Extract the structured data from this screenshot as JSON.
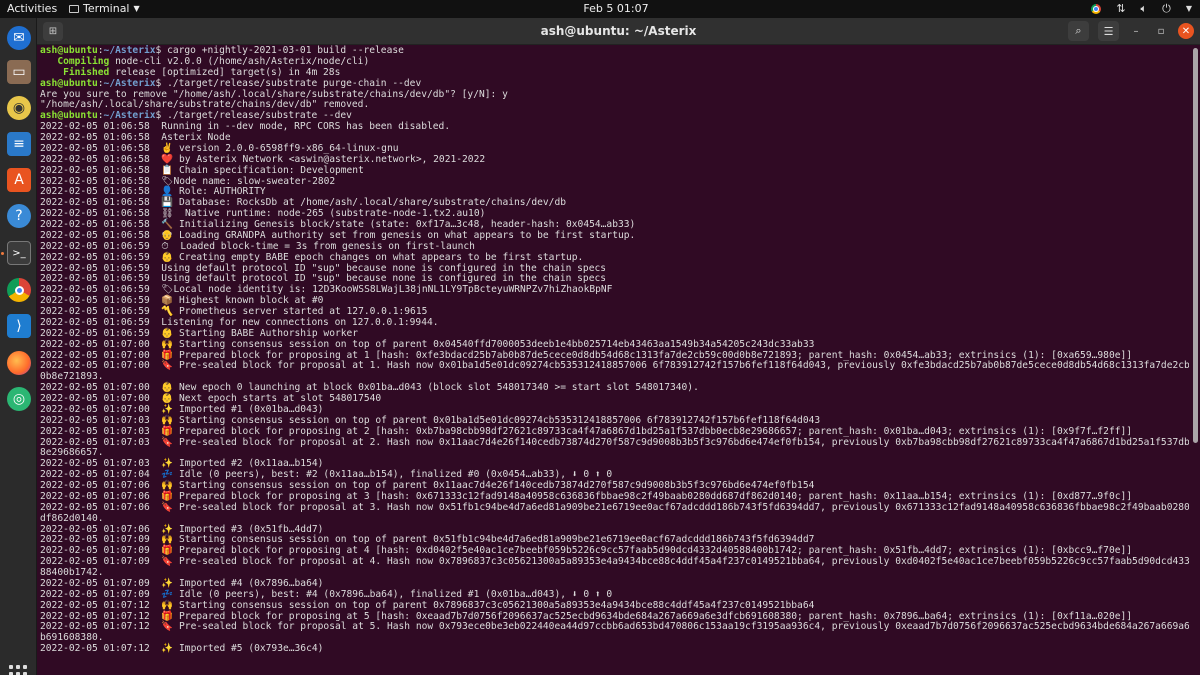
{
  "topbar": {
    "activities": "Activities",
    "app_name": "Terminal",
    "clock": "Feb 5  01:07"
  },
  "dock": {
    "apps": [
      {
        "name": "Thunderbird",
        "icon": "thunderbird-icon"
      },
      {
        "name": "Files",
        "icon": "files-icon"
      },
      {
        "name": "Rhythmbox",
        "icon": "rhythmbox-icon"
      },
      {
        "name": "LibreOffice Writer",
        "icon": "writer-icon"
      },
      {
        "name": "Ubuntu Software",
        "icon": "software-icon"
      },
      {
        "name": "Help",
        "icon": "help-icon"
      },
      {
        "name": "Terminal",
        "icon": "terminal-icon"
      },
      {
        "name": "Google Chrome",
        "icon": "chrome-icon"
      },
      {
        "name": "Visual Studio Code",
        "icon": "vscode-icon"
      },
      {
        "name": "Firefox",
        "icon": "firefox-icon"
      },
      {
        "name": "App",
        "icon": "green-app-icon"
      }
    ]
  },
  "window": {
    "title": "ash@ubuntu: ~/Asterix"
  },
  "terminal": {
    "lines": [
      {
        "u": "ash@ubuntu",
        "p": "~/Asterix",
        "t": "$ cargo +nightly-2021-03-01 build --release"
      },
      {
        "g": "   Compiling",
        "t": " node-cli v2.0.0 (/home/ash/Asterix/node/cli)"
      },
      {
        "g": "    Finished",
        "t": " release [optimized] target(s) in 4m 28s"
      },
      {
        "u": "ash@ubuntu",
        "p": "~/Asterix",
        "t": "$ ./target/release/substrate purge-chain --dev"
      },
      {
        "t": "Are you sure to remove \"/home/ash/.local/share/substrate/chains/dev/db\"? [y/N]: y"
      },
      {
        "t": "\"/home/ash/.local/share/substrate/chains/dev/db\" removed."
      },
      {
        "u": "ash@ubuntu",
        "p": "~/Asterix",
        "t": "$ ./target/release/substrate --dev"
      },
      {
        "t": "2022-02-05 01:06:58  Running in --dev mode, RPC CORS has been disabled."
      },
      {
        "t": "2022-02-05 01:06:58  Asterix Node"
      },
      {
        "t": "2022-02-05 01:06:58  ✌️ version 2.0.0-6598ff9-x86_64-linux-gnu"
      },
      {
        "t": "2022-02-05 01:06:58  ❤️ by Asterix Network <aswin@asterix.network>, 2021-2022"
      },
      {
        "t": "2022-02-05 01:06:58  📋 Chain specification: Development"
      },
      {
        "t": "2022-02-05 01:06:58  🏷Node name: slow-sweater-2802"
      },
      {
        "t": "2022-02-05 01:06:58  👤 Role: AUTHORITY"
      },
      {
        "t": "2022-02-05 01:06:58  💾 Database: RocksDb at /home/ash/.local/share/substrate/chains/dev/db"
      },
      {
        "t": "2022-02-05 01:06:58  ⛓  Native runtime: node-265 (substrate-node-1.tx2.au10)"
      },
      {
        "t": "2022-02-05 01:06:58  🔨 Initializing Genesis block/state (state: 0xf17a…3c48, header-hash: 0x0454…ab33)"
      },
      {
        "t": "2022-02-05 01:06:58  👴 Loading GRANDPA authority set from genesis on what appears to be first startup."
      },
      {
        "t": "2022-02-05 01:06:59  ⏱  Loaded block-time = 3s from genesis on first-launch"
      },
      {
        "t": "2022-02-05 01:06:59  👶 Creating empty BABE epoch changes on what appears to be first startup."
      },
      {
        "t": "2022-02-05 01:06:59  Using default protocol ID \"sup\" because none is configured in the chain specs"
      },
      {
        "t": "2022-02-05 01:06:59  Using default protocol ID \"sup\" because none is configured in the chain specs"
      },
      {
        "t": "2022-02-05 01:06:59  🏷Local node identity is: 12D3KooWSS8LWajL38jnNL1LY9TpBcteyuWRNPZv7hiZhaokBpNF"
      },
      {
        "t": "2022-02-05 01:06:59  📦 Highest known block at #0"
      },
      {
        "t": "2022-02-05 01:06:59  〽️ Prometheus server started at 127.0.0.1:9615"
      },
      {
        "t": "2022-02-05 01:06:59  Listening for new connections on 127.0.0.1:9944."
      },
      {
        "t": "2022-02-05 01:06:59  👶 Starting BABE Authorship worker"
      },
      {
        "t": "2022-02-05 01:07:00  🙌 Starting consensus session on top of parent 0x04540ffd7000053deeb1e4bb025714eb43463aa1549b34a54205c243dc33ab33"
      },
      {
        "t": "2022-02-05 01:07:00  🎁 Prepared block for proposing at 1 [hash: 0xfe3bdacd25b7ab0b87de5cece0d8db54d68c1313fa7de2cb59c00d0b8e721893; parent_hash: 0x0454…ab33; extrinsics (1): [0xa659…980e]]"
      },
      {
        "t": "2022-02-05 01:07:00  🔖 Pre-sealed block for proposal at 1. Hash now 0x01ba1d5e01dc09274cb535312418857006 6f783912742f157b6fef118f64d043, previously 0xfe3bdacd25b7ab0b87de5cece0d8db54d68c1313fa7de2cb59c00d"
      },
      {
        "t": "0b8e721893."
      },
      {
        "t": "2022-02-05 01:07:00  👶 New epoch 0 launching at block 0x01ba…d043 (block slot 548017340 >= start slot 548017340)."
      },
      {
        "t": "2022-02-05 01:07:00  👶 Next epoch starts at slot 548017540"
      },
      {
        "t": "2022-02-05 01:07:00  ✨ Imported #1 (0x01ba…d043)"
      },
      {
        "t": "2022-02-05 01:07:03  🙌 Starting consensus session on top of parent 0x01ba1d5e01dc09274cb535312418857006 6f783912742f157b6fef118f64d043"
      },
      {
        "t": "2022-02-05 01:07:03  🎁 Prepared block for proposing at 2 [hash: 0xb7ba98cbb98df27621c89733ca4f47a6867d1bd25a1f537dbb0ecb8e29686657; parent_hash: 0x01ba…d043; extrinsics (1): [0x9f7f…f2ff]]"
      },
      {
        "t": "2022-02-05 01:07:03  🔖 Pre-sealed block for proposal at 2. Hash now 0x11aac7d4e26f140cedb73874d270f587c9d9008b3b5f3c976bd6e474ef0fb154, previously 0xb7ba98cbb98df27621c89733ca4f47a6867d1bd25a1f537dbb0ecb"
      },
      {
        "t": "8e29686657."
      },
      {
        "t": "2022-02-05 01:07:03  ✨ Imported #2 (0x11aa…b154)"
      },
      {
        "t": "2022-02-05 01:07:04  💤 Idle (0 peers), best: #2 (0x11aa…b154), finalized #0 (0x0454…ab33), ⬇ 0 ⬆ 0"
      },
      {
        "t": "2022-02-05 01:07:06  🙌 Starting consensus session on top of parent 0x11aac7d4e26f140cedb73874d270f587c9d9008b3b5f3c976bd6e474ef0fb154"
      },
      {
        "t": "2022-02-05 01:07:06  🎁 Prepared block for proposing at 3 [hash: 0x671333c12fad9148a40958c636836fbbae98c2f49baab0280dd687df862d0140; parent_hash: 0x11aa…b154; extrinsics (1): [0xd877…9f0c]]"
      },
      {
        "t": "2022-02-05 01:07:06  🔖 Pre-sealed block for proposal at 3. Hash now 0x51fb1c94be4d7a6ed81a909be21e6719ee0acf67adcddd186b743f5fd6394dd7, previously 0x671333c12fad9148a40958c636836fbbae98c2f49baab0280dd687"
      },
      {
        "t": "df862d0140."
      },
      {
        "t": "2022-02-05 01:07:06  ✨ Imported #3 (0x51fb…4dd7)"
      },
      {
        "t": "2022-02-05 01:07:09  🙌 Starting consensus session on top of parent 0x51fb1c94be4d7a6ed81a909be21e6719ee0acf67adcddd186b743f5fd6394dd7"
      },
      {
        "t": "2022-02-05 01:07:09  🎁 Prepared block for proposing at 4 [hash: 0xd0402f5e40ac1ce7beebf059b5226c9cc57faab5d90dcd4332d40588400b1742; parent_hash: 0x51fb…4dd7; extrinsics (1): [0xbcc9…f70e]]"
      },
      {
        "t": "2022-02-05 01:07:09  🔖 Pre-sealed block for proposal at 4. Hash now 0x7896837c3c05621300a5a89353e4a9434bce88c4ddf45a4f237c0149521bba64, previously 0xd0402f5e40ac1ce7beebf059b5226c9cc57faab5d90dcd4332d405"
      },
      {
        "t": "88400b1742."
      },
      {
        "t": "2022-02-05 01:07:09  ✨ Imported #4 (0x7896…ba64)"
      },
      {
        "t": "2022-02-05 01:07:09  💤 Idle (0 peers), best: #4 (0x7896…ba64), finalized #1 (0x01ba…d043), ⬇ 0 ⬆ 0"
      },
      {
        "t": "2022-02-05 01:07:12  🙌 Starting consensus session on top of parent 0x7896837c3c05621300a5a89353e4a9434bce88c4ddf45a4f237c0149521bba64"
      },
      {
        "t": "2022-02-05 01:07:12  🎁 Prepared block for proposing at 5 [hash: 0xeaad7b7d0756f2096637ac525ecbd9634bde684a267a669a6e3dfcb691608380; parent_hash: 0x7896…ba64; extrinsics (1): [0xf11a…020e]]"
      },
      {
        "t": "2022-02-05 01:07:12  🔖 Pre-sealed block for proposal at 5. Hash now 0x793ece0be3eb022440ea44d97ccbb6ad653bd470806c153aa19cf3195aa936c4, previously 0xeaad7b7d0756f2096637ac525ecbd9634bde684a267a669a6e3dfc"
      },
      {
        "t": "b691608380."
      },
      {
        "t": "2022-02-05 01:07:12  ✨ Imported #5 (0x793e…36c4)"
      }
    ]
  }
}
